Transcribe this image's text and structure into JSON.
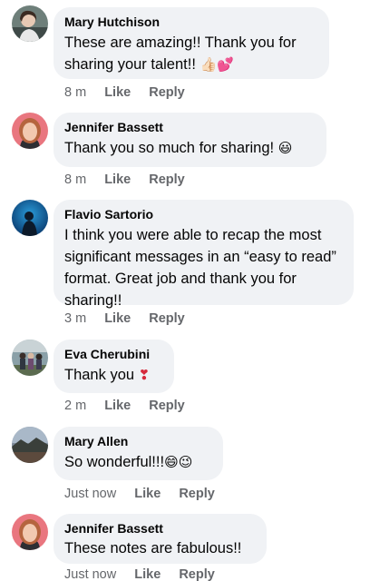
{
  "comments": [
    {
      "author": "Mary Hutchison",
      "text": "These are amazing!!  Thank you for sharing your talent!!",
      "emoji": "👍🏻💕",
      "time": "8 m",
      "like_label": "Like",
      "reply_label": "Reply"
    },
    {
      "author": "Jennifer Bassett",
      "text": "Thank you so much for sharing!",
      "emoji": "😃",
      "time": "8 m",
      "like_label": "Like",
      "reply_label": "Reply"
    },
    {
      "author": "Flavio Sartorio",
      "text": "I think you were able to recap the most significant messages in an “easy to read” format. Great job and thank you for sharing!!",
      "emoji": "",
      "time": "3 m",
      "like_label": "Like",
      "reply_label": "Reply"
    },
    {
      "author": "Eva Cherubini",
      "text": "Thank you",
      "emoji": "❣",
      "time": "2 m",
      "like_label": "Like",
      "reply_label": "Reply"
    },
    {
      "author": "Mary Allen",
      "text": "So wonderful!!!",
      "emoji": "😄😉",
      "time": "Just now",
      "like_label": "Like",
      "reply_label": "Reply"
    },
    {
      "author": "Jennifer Bassett",
      "text": "These notes are fabulous!!",
      "emoji": "",
      "time": "Just now",
      "like_label": "Like",
      "reply_label": "Reply"
    }
  ]
}
